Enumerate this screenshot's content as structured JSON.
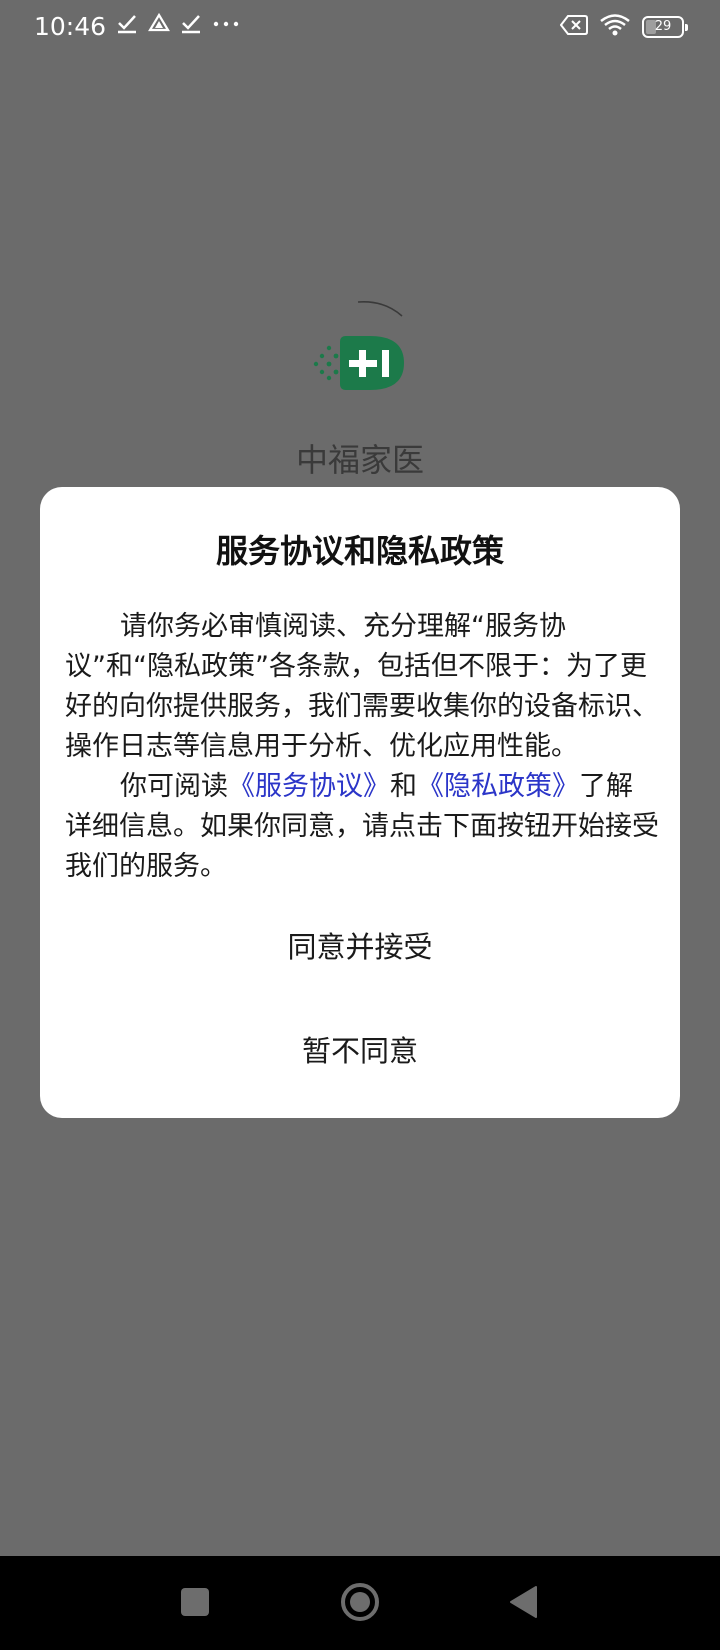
{
  "status_bar": {
    "time": "10:46",
    "notification_icons": [
      "check-icon",
      "drive-icon",
      "check-icon",
      "more-dots-icon"
    ],
    "battery_level": "29"
  },
  "splash": {
    "app_name": "中福家医",
    "logo_colors": {
      "green": "#1c7a4a"
    }
  },
  "dialog": {
    "title": "服务协议和隐私政策",
    "paragraph1": "请你务必审慎阅读、充分理解“服务协议”和“隐私政策”各条款，包括但不限于：为了更好的向你提供服务，我们需要收集你的设备标识、操作日志等信息用于分析、优化应用性能。",
    "paragraph2_prefix": "你可阅读",
    "link_service": "《服务协议》",
    "paragraph2_and": "和",
    "link_privacy": "《隐私政策》",
    "paragraph2_suffix": "了解详细信息。如果你同意，请点击下面按钮开始接受我们的服务。",
    "agree_label": "同意并接受",
    "disagree_label": "暂不同意"
  },
  "colors": {
    "overlay": "#6b6b6b",
    "link": "#2b35c8",
    "nav_bar": "#000000"
  }
}
